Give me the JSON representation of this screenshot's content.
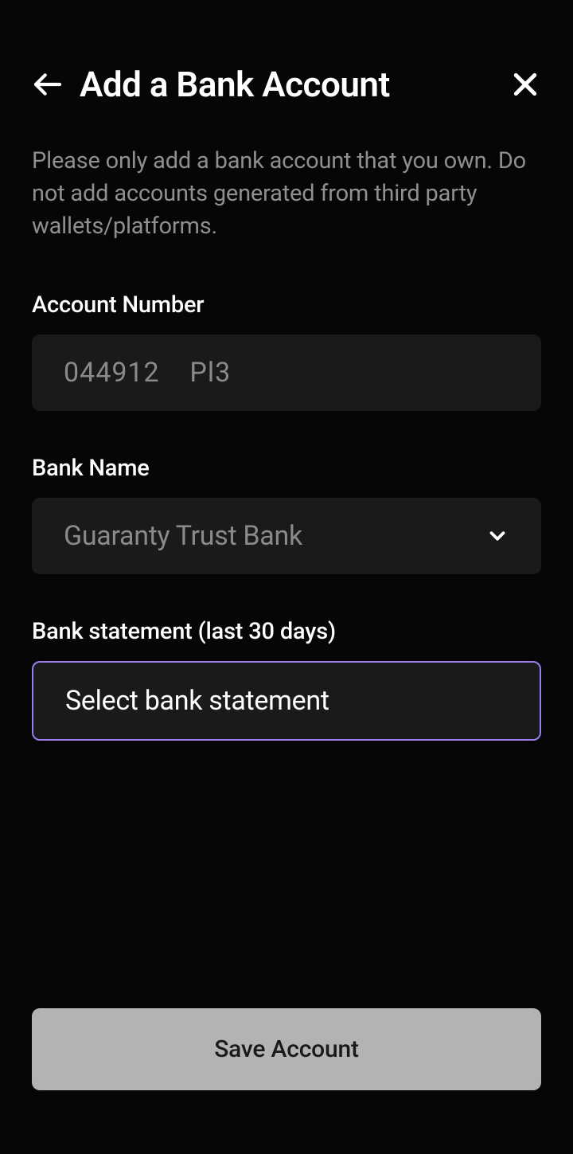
{
  "header": {
    "title": "Add a Bank Account"
  },
  "description": "Please only add a bank account that you own. Do not add accounts generated from third party wallets/platforms.",
  "fields": {
    "account_number": {
      "label": "Account Number",
      "value": "044912    Pl3"
    },
    "bank_name": {
      "label": "Bank Name",
      "value": "Guaranty Trust Bank"
    },
    "bank_statement": {
      "label": "Bank statement (last 30 days)",
      "placeholder": "Select bank statement"
    }
  },
  "actions": {
    "save": "Save Account"
  }
}
